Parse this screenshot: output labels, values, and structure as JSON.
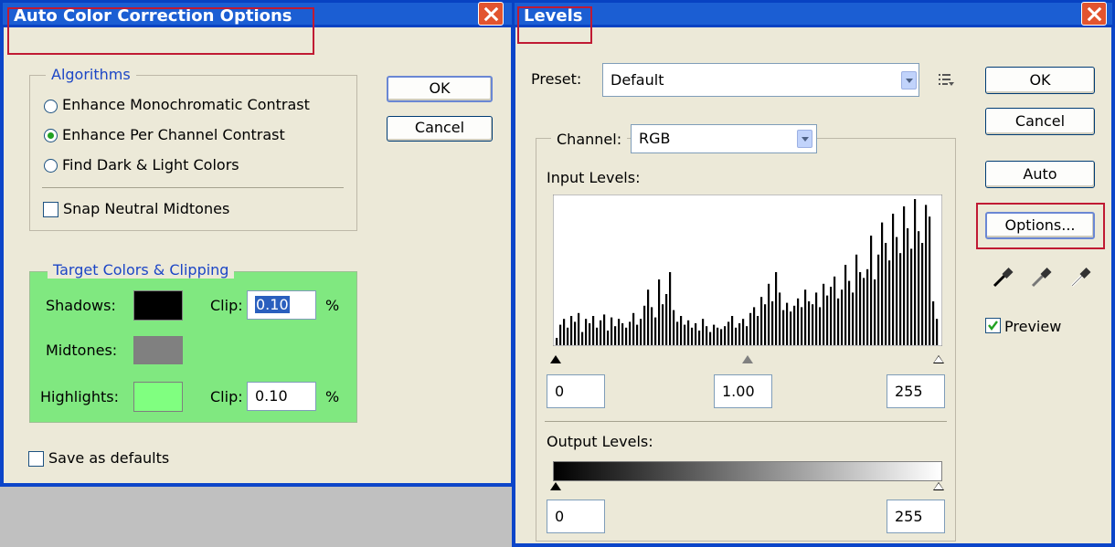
{
  "auto_color": {
    "title": "Auto Color Correction Options",
    "algorithms_legend": "Algorithms",
    "options": [
      {
        "label": "Enhance Monochromatic Contrast",
        "selected": false
      },
      {
        "label": "Enhance Per Channel Contrast",
        "selected": true
      },
      {
        "label": "Find Dark & Light Colors",
        "selected": false
      }
    ],
    "snap_neutral": {
      "label": "Snap Neutral Midtones",
      "checked": false
    },
    "target_legend": "Target Colors & Clipping",
    "shadows_label": "Shadows:",
    "midtones_label": "Midtones:",
    "highlights_label": "Highlights:",
    "clip_label": "Clip:",
    "shadows_clip": "0.10",
    "highlights_clip": "0.10",
    "percent": "%",
    "colors": {
      "shadows": "#000000",
      "midtones": "#808080",
      "highlights": "#80ff80",
      "target_panel": "#80e880"
    },
    "save_defaults": {
      "label": "Save as defaults",
      "checked": false
    },
    "ok_label": "OK",
    "cancel_label": "Cancel"
  },
  "levels": {
    "title": "Levels",
    "preset_label": "Preset:",
    "preset_value": "Default",
    "channel_label": "Channel:",
    "channel_value": "RGB",
    "input_levels_label": "Input Levels:",
    "input_black": "0",
    "input_gamma": "1.00",
    "input_white": "255",
    "output_levels_label": "Output Levels:",
    "output_black": "0",
    "output_white": "255",
    "ok_label": "OK",
    "cancel_label": "Cancel",
    "auto_label": "Auto",
    "options_label": "Options...",
    "preview": {
      "label": "Preview",
      "checked": true
    },
    "icons": [
      "preset-menu-icon",
      "black-eyedropper-icon",
      "gray-eyedropper-icon",
      "white-eyedropper-icon"
    ]
  },
  "chart_data": {
    "type": "bar",
    "title": "",
    "xlabel": "",
    "ylabel": "",
    "xlim": [
      0,
      255
    ],
    "ylim": [
      0,
      100
    ],
    "series": [
      {
        "values": [
          5,
          14,
          18,
          12,
          20,
          16,
          22,
          9,
          18,
          15,
          20,
          12,
          17,
          21,
          10,
          19,
          13,
          18,
          15,
          12,
          16,
          22,
          14,
          18,
          27,
          38,
          26,
          19,
          45,
          28,
          35,
          50,
          24,
          16,
          20,
          14,
          17,
          12,
          15,
          10,
          18,
          13,
          9,
          14,
          12,
          11,
          13,
          16,
          20,
          12,
          15,
          18,
          13,
          22,
          26,
          20,
          33,
          28,
          42,
          30,
          50,
          36,
          24,
          29,
          23,
          27,
          32,
          26,
          38,
          30,
          28,
          36,
          26,
          42,
          34,
          40,
          47,
          32,
          38,
          55,
          44,
          36,
          62,
          50,
          46,
          52,
          75,
          45,
          62,
          84,
          70,
          58,
          90,
          74,
          63,
          95,
          80,
          66,
          100,
          78,
          70,
          96,
          88,
          30,
          18
        ]
      }
    ]
  }
}
